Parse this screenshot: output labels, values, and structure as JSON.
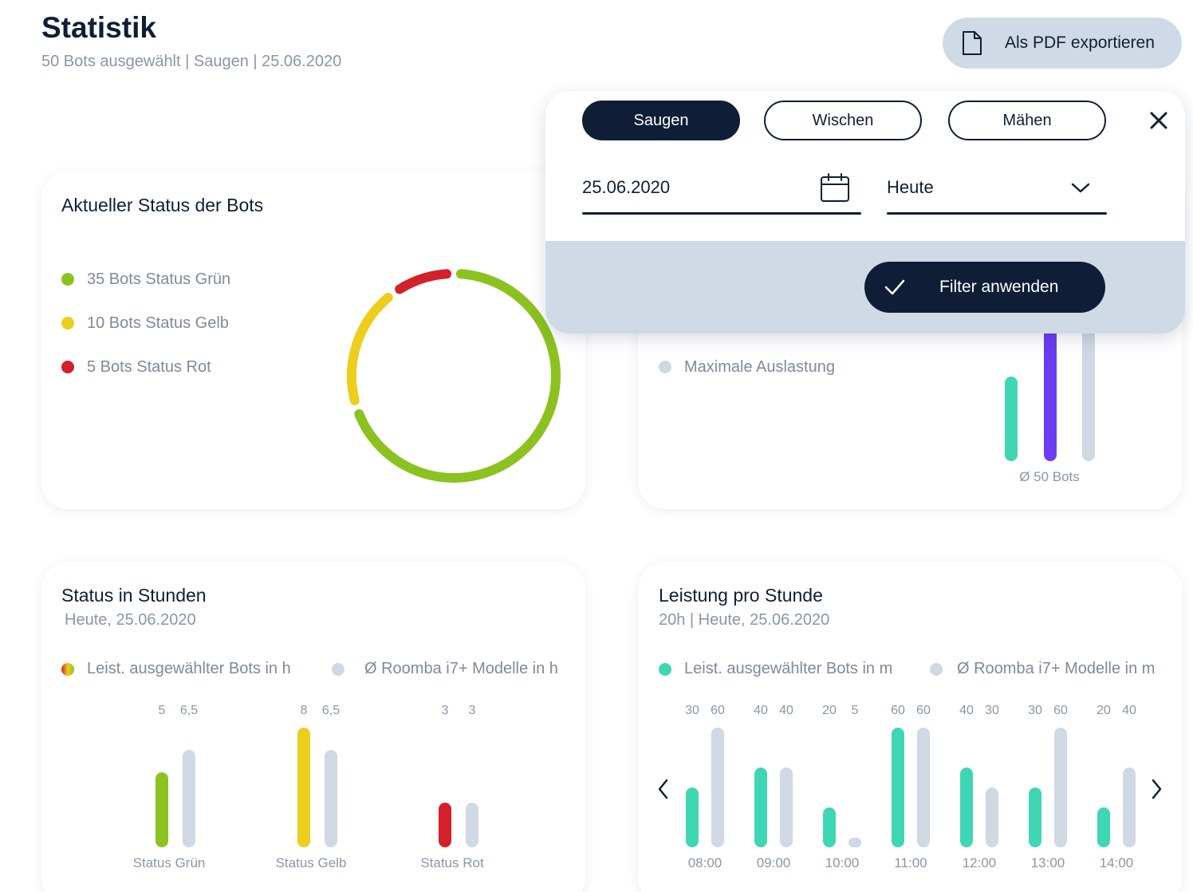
{
  "header": {
    "title": "Statistik",
    "subtitle": "50 Bots ausgewählt | Saugen | 25.06.2020",
    "pdf_button": "Als PDF exportieren"
  },
  "status_card": {
    "title": "Aktueller Status der Bots",
    "legend": [
      {
        "label": "35 Bots Status Grün",
        "color": "#8cc21f"
      },
      {
        "label": "10 Bots Status Gelb",
        "color": "#ecce1c"
      },
      {
        "label": "5 Bots Status Rot",
        "color": "#d4202a"
      }
    ],
    "donut": [
      {
        "value": 35,
        "color": "#8cc21f"
      },
      {
        "value": 10,
        "color": "#ecce1c"
      },
      {
        "value": 5,
        "color": "#d4202a"
      }
    ]
  },
  "capacity_card": {
    "legend_label": "Maximale Auslastung",
    "legend_color": "#cfd8e3",
    "bar_label": "Ø 50 Bots"
  },
  "filter": {
    "tabs": [
      "Saugen",
      "Wischen",
      "Mähen"
    ],
    "active_tab": "Saugen",
    "date_value": "25.06.2020",
    "range_value": "Heute",
    "apply_label": "Filter anwenden"
  },
  "hours_card": {
    "title": "Status in Stunden",
    "subtitle": "Heute, 25.06.2020",
    "legend_selected": "Leist. ausgewählter Bots in h",
    "legend_avg": "Ø Roomba i7+ Modelle in h"
  },
  "perf_card": {
    "title": "Leistung pro Stunde",
    "subtitle": "20h | Heute, 25.06.2020",
    "legend_selected": "Leist. ausgewählter Bots in m",
    "legend_avg": "Ø Roomba i7+ Modelle in m"
  },
  "colors": {
    "navy": "#0f1e36",
    "teal": "#3fd6b4",
    "grey_bar": "#cfd8e3",
    "purple": "#6a3cf2",
    "green": "#8cc21f",
    "yellow": "#ecce1c",
    "red": "#d4202a"
  },
  "chart_data": [
    {
      "type": "bar",
      "categories": [
        "Status Grün",
        "Status Gelb",
        "Status Rot"
      ],
      "series": [
        {
          "name": "Leist. ausgewählter Bots in h",
          "values": [
            5,
            8,
            3
          ]
        },
        {
          "name": "Ø Roomba i7+ Modelle in h",
          "values": [
            6.5,
            6.5,
            3
          ]
        }
      ],
      "value_labels": [
        [
          "5",
          "6,5"
        ],
        [
          "8",
          "6,5"
        ],
        [
          "3",
          "3"
        ]
      ]
    },
    {
      "type": "bar",
      "categories": [
        "08:00",
        "09:00",
        "10:00",
        "11:00",
        "12:00",
        "13:00",
        "14:00"
      ],
      "series": [
        {
          "name": "Leist. ausgewählter Bots in m",
          "values": [
            30,
            40,
            20,
            60,
            40,
            30,
            20
          ]
        },
        {
          "name": "Ø Roomba i7+ Modelle in m",
          "values": [
            60,
            40,
            5,
            60,
            30,
            60,
            40
          ]
        }
      ]
    }
  ]
}
